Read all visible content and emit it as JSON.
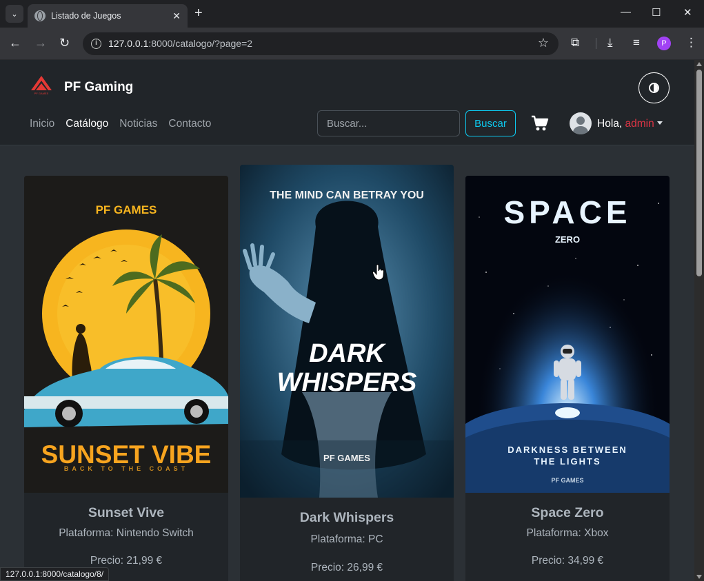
{
  "browser": {
    "tab_title": "Listado de Juegos",
    "url_host": "127.0.0.1",
    "url_path": ":8000/catalogo/?page=2",
    "profile_initial": "P",
    "status_url": "127.0.0.1:8000/catalogo/8/"
  },
  "header": {
    "brand": "PF Gaming",
    "logo_text": "PF GAMES",
    "nav": [
      "Inicio",
      "Catálogo",
      "Noticias",
      "Contacto"
    ],
    "active_nav": "Catálogo",
    "search_placeholder": "Buscar...",
    "search_button": "Buscar",
    "greeting": "Hola,",
    "username": "admin"
  },
  "games": [
    {
      "title": "Sunset Vive",
      "platform": "Plataforma: Nintendo Switch",
      "price": "Precio: 21,99 €",
      "poster": {
        "studio": "PF GAMES",
        "headline": "SUNSET VIBE",
        "tagline": "BACK TO THE COAST"
      }
    },
    {
      "title": "Dark Whispers",
      "platform": "Plataforma: PC",
      "price": "Precio: 26,99 €",
      "poster": {
        "tagline": "THE MIND CAN BETRAY YOU",
        "headline_1": "DARK",
        "headline_2": "WHISPERS",
        "studio": "PF GAMES"
      }
    },
    {
      "title": "Space Zero",
      "platform": "Plataforma: Xbox",
      "price": "Precio: 34,99 €",
      "poster": {
        "headline": "SPACE",
        "sub": "ZERO",
        "tagline_1": "DARKNESS BETWEEN",
        "tagline_2": "THE LIGHTS",
        "studio": "PF GAMES"
      }
    }
  ],
  "colors": {
    "accent": "#0dcaf0",
    "username": "#dc3545",
    "brand_logo": "#e53935"
  }
}
